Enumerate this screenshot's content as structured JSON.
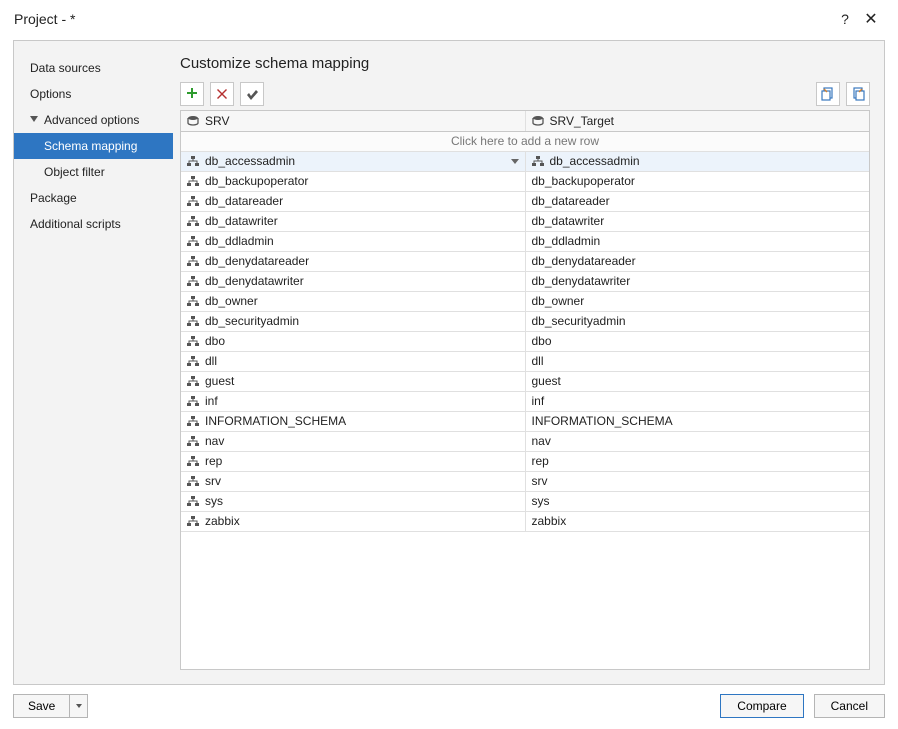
{
  "window": {
    "title": "Project  - *"
  },
  "sidebar": {
    "data_sources": "Data sources",
    "options": "Options",
    "advanced_options": "Advanced options",
    "schema_mapping": "Schema mapping",
    "object_filter": "Object filter",
    "package": "Package",
    "additional_scripts": "Additional scripts"
  },
  "page": {
    "title": "Customize schema mapping"
  },
  "grid": {
    "header_left": "SRV",
    "header_right": "SRV_Target",
    "add_row": "Click here to add a new row",
    "rows": [
      {
        "left": "db_accessadmin",
        "right": "db_accessadmin",
        "selected": true
      },
      {
        "left": "db_backupoperator",
        "right": "db_backupoperator"
      },
      {
        "left": "db_datareader",
        "right": "db_datareader"
      },
      {
        "left": "db_datawriter",
        "right": "db_datawriter"
      },
      {
        "left": "db_ddladmin",
        "right": "db_ddladmin"
      },
      {
        "left": "db_denydatareader",
        "right": "db_denydatareader"
      },
      {
        "left": "db_denydatawriter",
        "right": "db_denydatawriter"
      },
      {
        "left": "db_owner",
        "right": "db_owner"
      },
      {
        "left": "db_securityadmin",
        "right": "db_securityadmin"
      },
      {
        "left": "dbo",
        "right": "dbo"
      },
      {
        "left": "dll",
        "right": "dll"
      },
      {
        "left": "guest",
        "right": "guest"
      },
      {
        "left": "inf",
        "right": "inf"
      },
      {
        "left": "INFORMATION_SCHEMA",
        "right": "INFORMATION_SCHEMA"
      },
      {
        "left": "nav",
        "right": "nav"
      },
      {
        "left": "rep",
        "right": "rep"
      },
      {
        "left": "srv",
        "right": "srv"
      },
      {
        "left": "sys",
        "right": "sys"
      },
      {
        "left": "zabbix",
        "right": "zabbix"
      }
    ]
  },
  "footer": {
    "save": "Save",
    "compare": "Compare",
    "cancel": "Cancel"
  }
}
